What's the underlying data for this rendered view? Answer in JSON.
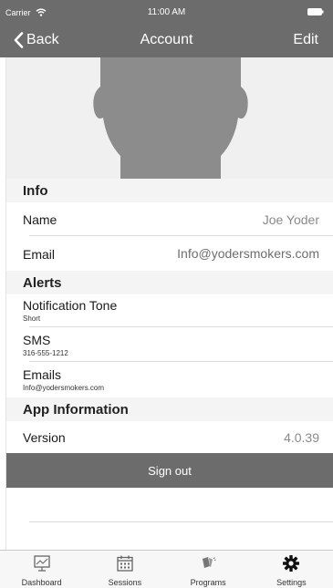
{
  "status_bar": {
    "carrier": "Carrier",
    "time": "11:00 AM"
  },
  "nav": {
    "back_label": "Back",
    "title": "Account",
    "edit_label": "Edit"
  },
  "info": {
    "header": "Info",
    "name_label": "Name",
    "name_value": "Joe Yoder",
    "email_label": "Email",
    "email_value": "Info@yodersmokers.com"
  },
  "alerts": {
    "header": "Alerts",
    "notification_label": "Notification Tone",
    "notification_value": "Short",
    "sms_label": "SMS",
    "sms_value": "316-555-1212",
    "emails_label": "Emails",
    "emails_value": "Info@yodersmokers.com"
  },
  "app_info": {
    "header": "App Information",
    "version_label": "Version",
    "version_value": "4.0.39"
  },
  "sign_out_label": "Sign out",
  "tabs": [
    {
      "label": "Dashboard",
      "icon": "dashboard-icon"
    },
    {
      "label": "Sessions",
      "icon": "calendar-icon"
    },
    {
      "label": "Programs",
      "icon": "programs-icon"
    },
    {
      "label": "Settings",
      "icon": "gear-icon"
    }
  ],
  "colors": {
    "nav_background": "#6c6c6c",
    "section_background": "#f4f4f4",
    "value_text": "#8a8a8a"
  }
}
